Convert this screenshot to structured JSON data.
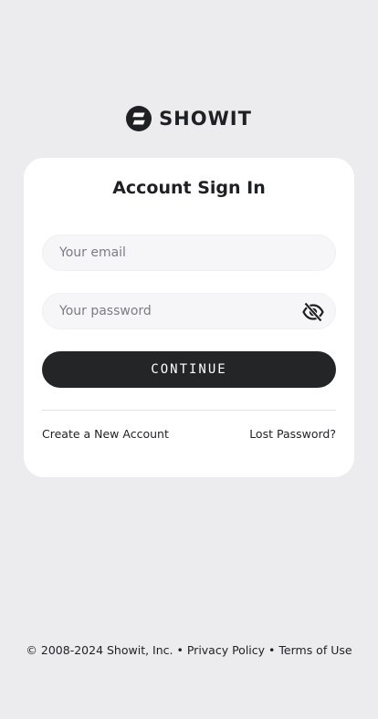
{
  "brand": {
    "name": "SHOWIT"
  },
  "card": {
    "title": "Account Sign In",
    "email_placeholder": "Your email",
    "password_placeholder": "Your password",
    "continue_label": "CONTINUE",
    "create_account_label": "Create a New Account",
    "lost_password_label": "Lost Password?"
  },
  "footer": {
    "copyright": "© 2008-2024 Showit, Inc.",
    "separator": "•",
    "privacy_label": "Privacy Policy",
    "terms_label": "Terms of Use"
  },
  "icons": {
    "logo": "showit-logo-icon",
    "password_toggle": "eye-slash-icon"
  },
  "colors": {
    "background": "#ececef",
    "card": "#ffffff",
    "input_bg": "#f6f6f8",
    "button_bg": "#242527",
    "text": "#1f2023",
    "placeholder": "#7a7c82"
  }
}
